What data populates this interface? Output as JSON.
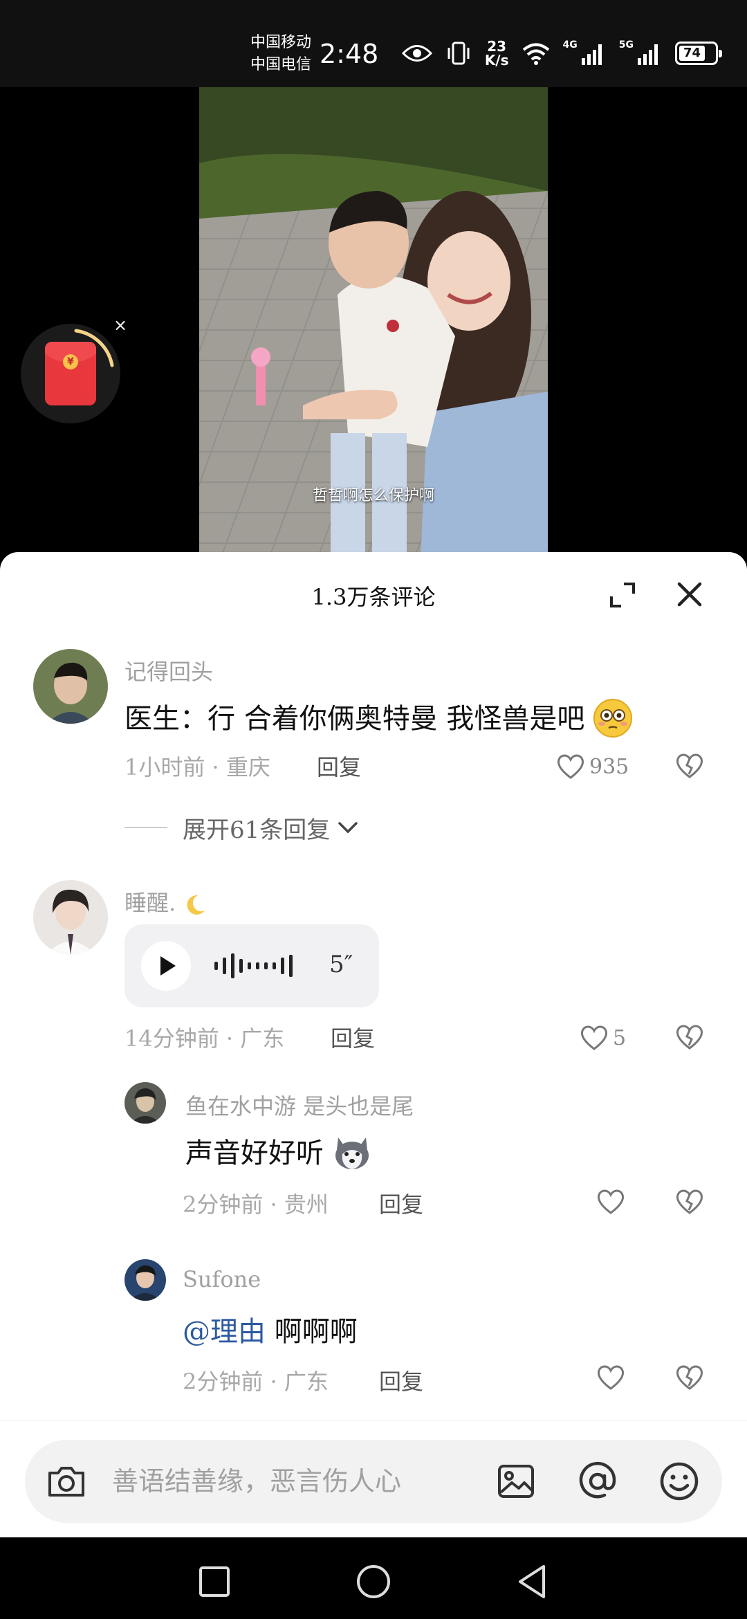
{
  "status_bar": {
    "carrier_1": "中国移动",
    "carrier_2": "中国电信",
    "time": "2:48",
    "net_speed_value": "23",
    "net_speed_unit": "K/s",
    "network_1": "4G",
    "network_2": "5G",
    "battery": "74",
    "battery_level": 0.74
  },
  "video": {
    "caption": "哲哲啊怎么保护啊",
    "red_packet_symbol": "¥",
    "red_packet_close": "×"
  },
  "comments_panel": {
    "title": "1.3万条评论",
    "comments": [
      {
        "nickname": "记得回头",
        "text": "医生：行 合着你俩奥特曼 我怪兽是吧",
        "time_location": "1小时前 · 重庆",
        "reply_label": "回复",
        "likes": "935",
        "expand_replies": "展开61条回复"
      },
      {
        "nickname": "睡醒.",
        "voice_duration": "5″",
        "time_location": "14分钟前 · 广东",
        "reply_label": "回复",
        "likes": "5",
        "replies": [
          {
            "nickname": "鱼在水中游 是头也是尾",
            "text": "声音好好听",
            "time_location": "2分钟前 · 贵州",
            "reply_label": "回复"
          },
          {
            "nickname": "Sufone",
            "mention": "@理由",
            "text": " 啊啊啊",
            "time_location": "2分钟前 · 广东",
            "reply_label": "回复"
          }
        ]
      }
    ]
  },
  "input": {
    "placeholder": "善语结善缘，恶言伤人心"
  },
  "colors": {
    "panel_bg": "#ffffff",
    "mention": "#2c5aa0",
    "red_packet": "#e8383d"
  }
}
